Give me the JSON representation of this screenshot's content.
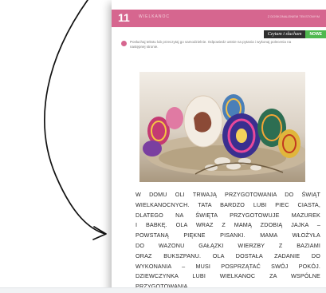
{
  "page": {
    "number": "11",
    "header_title": "WIELKANOC",
    "header_right": "Z DOSKONALENIEM TEKSTOWYM",
    "tag_italic": "Czytam i słucham",
    "tag_green": "NOWE",
    "instruction": "Posłuchaj tekstu lub przeczytaj go samodzielnie. Odpowiedz ustnie na pytania i wykonaj polecenia na następnej stronie.",
    "photo_label": "pisanki",
    "story_lines": [
      "W DOMU OLI TRWAJĄ PRZYGOTOWANIA DO ŚWIĄT",
      "WIELKANOCNYCH. TATA BARDZO LUBI PIEC CIASTA,",
      "DLATEGO NA ŚWIĘTA PRZYGOTOWUJE MAZUREK",
      "I BABKĘ. OLA WRAZ Z MAMĄ ZDOBIĄ JAJKA –",
      "POWSTANĄ PIĘKNE PISANKI. MAMA WŁOŻYŁA",
      "DO WAZONU GAŁĄZKI WIERZBY Z BAZIAMI",
      "ORAZ BUKSZPANU. OLA DOSTAŁA ZADANIE DO",
      "WYKONANIA – MUSI POSPRZĄTAĆ SWÓJ POKÓJ.",
      "DZIEWCZYNKA LUBI WIELKANOC ZA WSPÓLNE",
      "PRZYGOTOWANIA."
    ]
  },
  "colors": {
    "header": "#d6668f",
    "tag_dark": "#2f2f2f",
    "tag_green": "#4fb84f",
    "text": "#2a2a2a"
  },
  "icons": {
    "bullet": "pink-dot",
    "arrow": "curved-arrow"
  }
}
